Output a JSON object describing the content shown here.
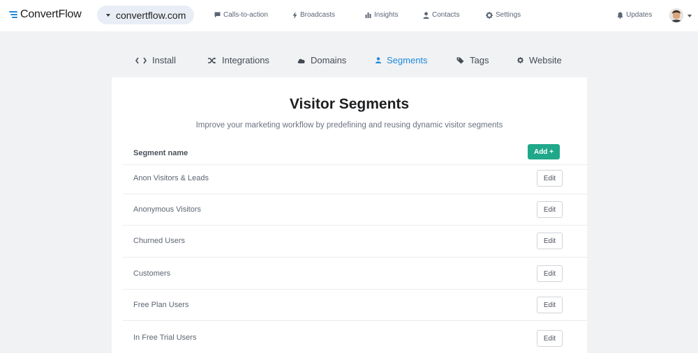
{
  "brand": {
    "name": "ConvertFlow"
  },
  "site_selector": {
    "value": "convertflow.com"
  },
  "nav": {
    "calls_to_action": "Calls-to-action",
    "broadcasts": "Broadcasts",
    "insights": "Insights",
    "contacts": "Contacts",
    "settings": "Settings",
    "updates": "Updates"
  },
  "tabs": {
    "install": "Install",
    "integrations": "Integrations",
    "domains": "Domains",
    "segments": "Segments",
    "tags": "Tags",
    "website": "Website",
    "active": "segments"
  },
  "page": {
    "title": "Visitor Segments",
    "subtitle": "Improve your marketing workflow by predefining and reusing dynamic visitor segments",
    "column_header": "Segment name",
    "add_label": "Add +",
    "edit_label": "Edit"
  },
  "segments": [
    "Anon Visitors & Leads",
    "Anonymous Visitors",
    "Churned Users",
    "Customers",
    "Free Plan Users",
    "In Free Trial Users"
  ],
  "colors": {
    "accent": "#1d8ad9",
    "add_button": "#1fa88a",
    "background": "#f1f2f4"
  }
}
